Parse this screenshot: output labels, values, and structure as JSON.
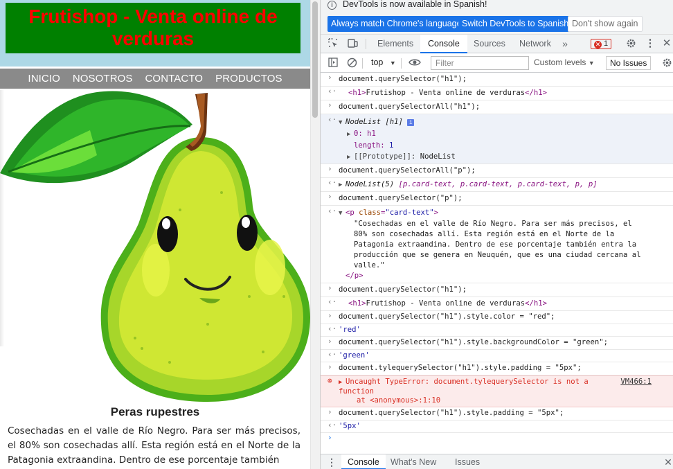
{
  "webpage": {
    "title": "Frutishop - Venta online de verduras",
    "nav": [
      "INICIO",
      "NOSOTROS",
      "CONTACTO",
      "PRODUCTOS"
    ],
    "card_title": "Peras rupestres",
    "card_text": "Cosechadas en el valle de Río Negro. Para ser más precisos, el 80% son cosechadas allí. Esta región está en el Norte de la Patagonia extraandina. Dentro de ese porcentaje también",
    "colors": {
      "header_bg": "#add8e6",
      "title_bg": "#008000",
      "title_color": "#ff0000",
      "nav_bg": "#8a8a8a"
    }
  },
  "devtools": {
    "infobar": {
      "message": "DevTools is now available in Spanish!",
      "btn_match": "Always match Chrome's language",
      "btn_switch": "Switch DevTools to Spanish",
      "btn_dismiss": "Don't show again"
    },
    "tabs": [
      "Elements",
      "Console",
      "Sources",
      "Network"
    ],
    "active_tab": "Console",
    "error_count": "1",
    "toolbar": {
      "context": "top",
      "filter_placeholder": "Filter",
      "levels": "Custom levels",
      "issues": "No Issues"
    },
    "console": {
      "c1": "document.querySelector(\"h1\");",
      "r1": "Frutishop - Venta online de verduras",
      "c2": "document.querySelectorAll(\"h1\");",
      "nodelist_h1": "NodeList [h1]",
      "item0_key": "0:",
      "item0_val": "h1",
      "length_key": "length:",
      "length_val": "1",
      "proto_key": "[[Prototype]]:",
      "proto_val": "NodeList",
      "c3": "document.querySelectorAll(\"p\");",
      "r3_prefix": "NodeList(5)",
      "r3_items": "[p.card-text, p.card-text, p.card-text, p, p]",
      "c4": "document.querySelector(\"p\");",
      "p_attr_name": "class",
      "p_attr_val": "\"card-text\"",
      "p_text_1": "\"Cosechadas en el valle de Río Negro. Para ser más precisos, el",
      "p_text_2": "80% son cosechadas allí. Esta región está en el Norte de la",
      "p_text_3": "Patagonia extraandina. Dentro de ese porcentaje también entra la",
      "p_text_4": "producción que se genera en Neuquén, que es una ciudad cercana al",
      "p_text_5": "valle.\"",
      "c5": "document.querySelector(\"h1\");",
      "r5": "Frutishop - Venta online de verduras",
      "c6": "document.querySelector(\"h1\").style.color = \"red\";",
      "r6": "'red'",
      "c7": "document.querySelector(\"h1\").style.backgroundColor = \"green\";",
      "r7": "'green'",
      "c8": "document.tylequerySelector(\"h1\").style.padding = \"5px\";",
      "err_msg_1": "Uncaught TypeError: document.tylequerySelector is not a",
      "err_msg_2": "function",
      "err_stack": "at <anonymous>:1:10",
      "err_link": "VM466:1",
      "c9": "document.querySelector(\"h1\").style.padding = \"5px\";",
      "r9": "'5px'"
    },
    "drawer_tabs": [
      "Console",
      "What's New",
      "Issues"
    ]
  }
}
